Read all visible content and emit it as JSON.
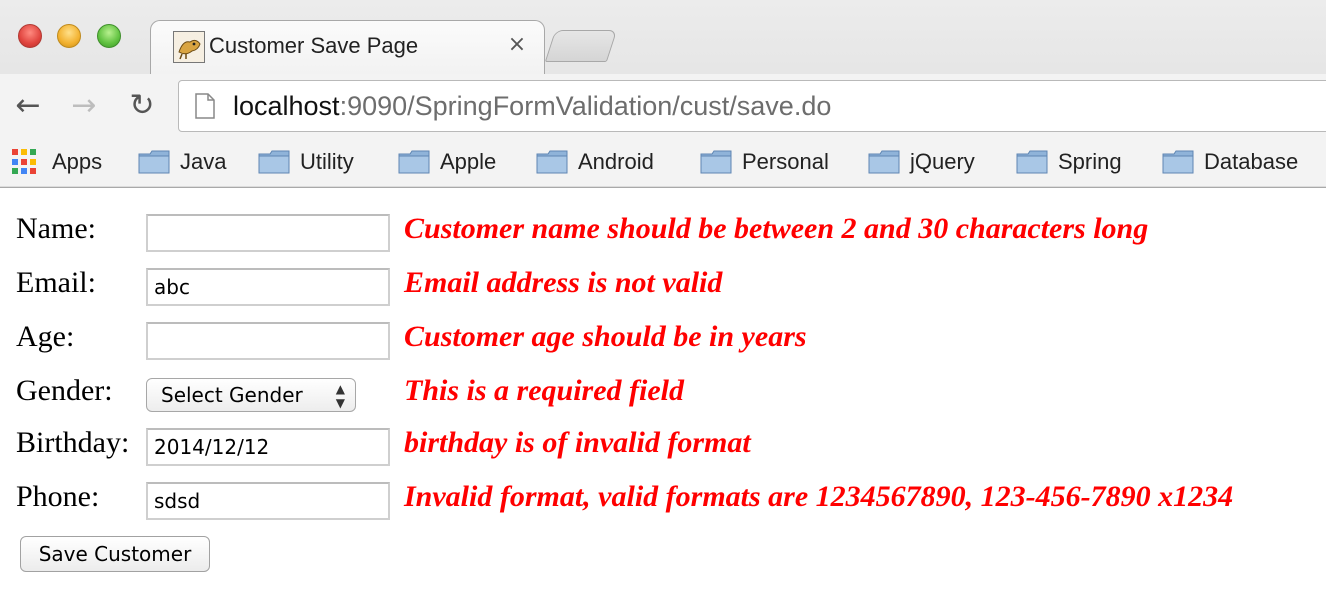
{
  "browser": {
    "tab_title": "Customer Save Page",
    "tab_close": "×",
    "url_host": "localhost",
    "url_rest": ":9090/SpringFormValidation/cust/save.do",
    "back_glyph": "←",
    "forward_glyph": "→",
    "reload_glyph": "↻"
  },
  "bookmarks": {
    "apps": "Apps",
    "items": [
      "Java",
      "Utility",
      "Apple",
      "Android",
      "Personal",
      "jQuery",
      "Spring",
      "Database"
    ]
  },
  "form": {
    "fields": [
      {
        "label": "Name:",
        "value": "",
        "error": "Customer name should be between 2 and 30 characters long"
      },
      {
        "label": "Email:",
        "value": "abc",
        "error": "Email address is not valid"
      },
      {
        "label": "Age:",
        "value": "",
        "error": "Customer age should be in years"
      },
      {
        "label": "Gender:",
        "value": "Select Gender",
        "error": "This is a required field"
      },
      {
        "label": "Birthday:",
        "value": "2014/12/12",
        "error": "birthday is of invalid format"
      },
      {
        "label": "Phone:",
        "value": "sdsd",
        "error": "Invalid format, valid formats are 1234567890, 123-456-7890 x1234"
      }
    ],
    "submit_label": "Save Customer"
  },
  "colors": {
    "error": "#ff0000",
    "apps_grid": [
      "#ea4335",
      "#fbbc05",
      "#34a853",
      "#4285f4",
      "#ea4335",
      "#fbbc05",
      "#34a853",
      "#4285f4",
      "#ea4335"
    ]
  }
}
